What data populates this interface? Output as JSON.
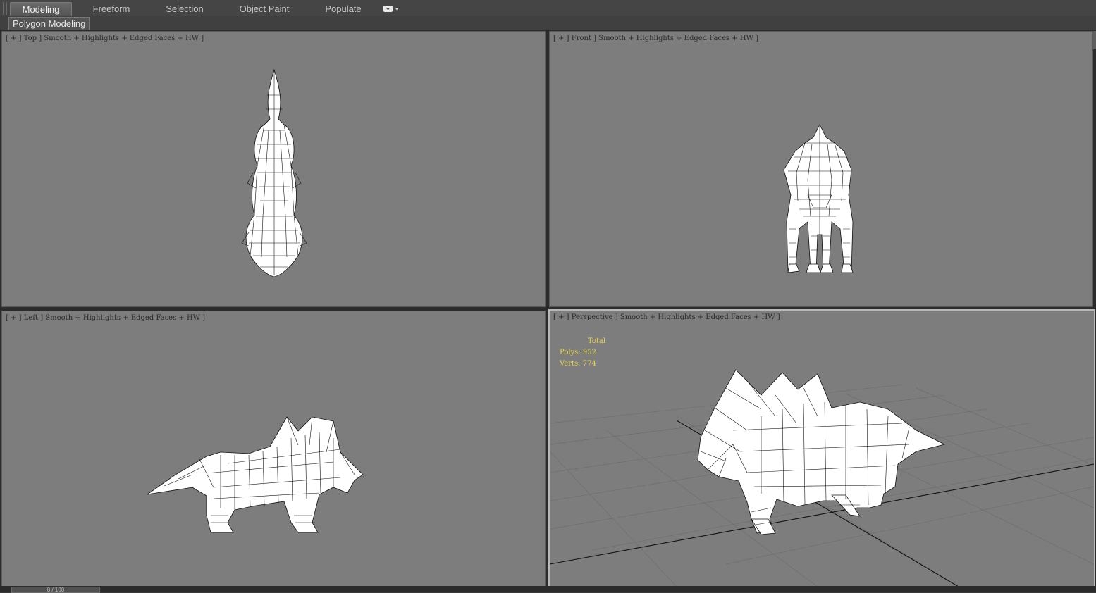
{
  "ribbon": {
    "tabs": [
      {
        "label": "Modeling",
        "active": true
      },
      {
        "label": "Freeform",
        "active": false
      },
      {
        "label": "Selection",
        "active": false
      },
      {
        "label": "Object Paint",
        "active": false
      },
      {
        "label": "Populate",
        "active": false
      }
    ],
    "dropdown_icon": "ribbon-options-icon"
  },
  "subbar": {
    "panel_label": "Polygon Modeling"
  },
  "viewports": {
    "top": {
      "plus": "+",
      "name": "Top",
      "shading": "Smooth + Highlights + Edged Faces + HW"
    },
    "front": {
      "plus": "+",
      "name": "Front",
      "shading": "Smooth + Highlights + Edged Faces + HW"
    },
    "left": {
      "plus": "+",
      "name": "Left",
      "shading": "Smooth + Highlights + Edged Faces + HW"
    },
    "perspective": {
      "plus": "+",
      "name": "Perspective",
      "shading": "Smooth + Highlights + Edged Faces + HW",
      "stats": {
        "header": "Total",
        "polys_label": "Polys:",
        "polys": "952",
        "verts_label": "Verts:",
        "verts": "774"
      }
    }
  },
  "timeline": {
    "frame": "0 / 100"
  },
  "colors": {
    "viewport_bg": "#7d7d7d",
    "stats_text": "#e8d34a",
    "ui_bg": "#454545"
  }
}
